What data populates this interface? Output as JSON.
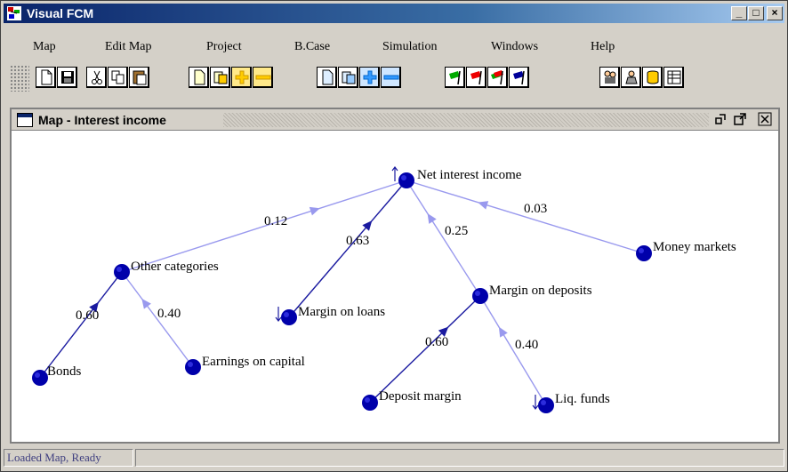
{
  "window": {
    "title": "Visual FCM",
    "controls": [
      "_",
      "□",
      "×"
    ]
  },
  "menu": [
    "Map",
    "Edit Map",
    "Project",
    "B.Case",
    "Simulation",
    "Windows",
    "Help"
  ],
  "toolbar": {
    "buttons": [
      {
        "name": "new-icon"
      },
      {
        "name": "save-icon"
      },
      {
        "name": "cut-icon"
      },
      {
        "name": "copy-icon"
      },
      {
        "name": "paste-icon"
      },
      {
        "name": "new-node-icon"
      },
      {
        "name": "open-node-icon"
      },
      {
        "name": "add-yellow-icon"
      },
      {
        "name": "remove-yellow-icon"
      },
      {
        "name": "new-edge-icon"
      },
      {
        "name": "open-edge-icon"
      },
      {
        "name": "add-blue-icon"
      },
      {
        "name": "remove-blue-icon"
      },
      {
        "name": "green-flag-icon"
      },
      {
        "name": "red-flag-icon"
      },
      {
        "name": "multi-flag-icon"
      },
      {
        "name": "blue-flag-icon"
      },
      {
        "name": "people-icon"
      },
      {
        "name": "group-icon"
      },
      {
        "name": "database-icon"
      },
      {
        "name": "table-icon"
      }
    ],
    "colors": {
      "yellow": "#ffcc00",
      "blue": "#3399ff",
      "green": "#00aa00",
      "red": "#ee0000",
      "navy": "#000099"
    }
  },
  "child_window": {
    "title": "Map - Interest income",
    "controls": [
      "restore",
      "maximize",
      "close"
    ]
  },
  "map": {
    "node_color": "#0000aa",
    "edge_colors": {
      "dark": "#1a1aa0",
      "light": "#9999ee"
    },
    "nodes": [
      {
        "id": "nii",
        "label": "Net interest income"
      },
      {
        "id": "oc",
        "label": "Other categories"
      },
      {
        "id": "mol",
        "label": "Margin on loans"
      },
      {
        "id": "mod",
        "label": "Margin on deposits"
      },
      {
        "id": "mm",
        "label": "Money markets"
      },
      {
        "id": "bonds",
        "label": "Bonds"
      },
      {
        "id": "eoc",
        "label": "Earnings on capital"
      },
      {
        "id": "dm",
        "label": "Deposit margin"
      },
      {
        "id": "lf",
        "label": "Liq. funds"
      }
    ],
    "edges": [
      {
        "from": "oc",
        "to": "nii",
        "weight": "0.12",
        "shade": "light"
      },
      {
        "from": "mol",
        "to": "nii",
        "weight": "0.63",
        "shade": "dark"
      },
      {
        "from": "mod",
        "to": "nii",
        "weight": "0.25",
        "shade": "light"
      },
      {
        "from": "mm",
        "to": "nii",
        "weight": "0.03",
        "shade": "light"
      },
      {
        "from": "bonds",
        "to": "oc",
        "weight": "0.60",
        "shade": "dark"
      },
      {
        "from": "eoc",
        "to": "oc",
        "weight": "0.40",
        "shade": "light"
      },
      {
        "from": "dm",
        "to": "mod",
        "weight": "0.60",
        "shade": "dark"
      },
      {
        "from": "lf",
        "to": "mod",
        "weight": "0.40",
        "shade": "light"
      }
    ]
  },
  "status": {
    "text": "Loaded Map, Ready"
  }
}
